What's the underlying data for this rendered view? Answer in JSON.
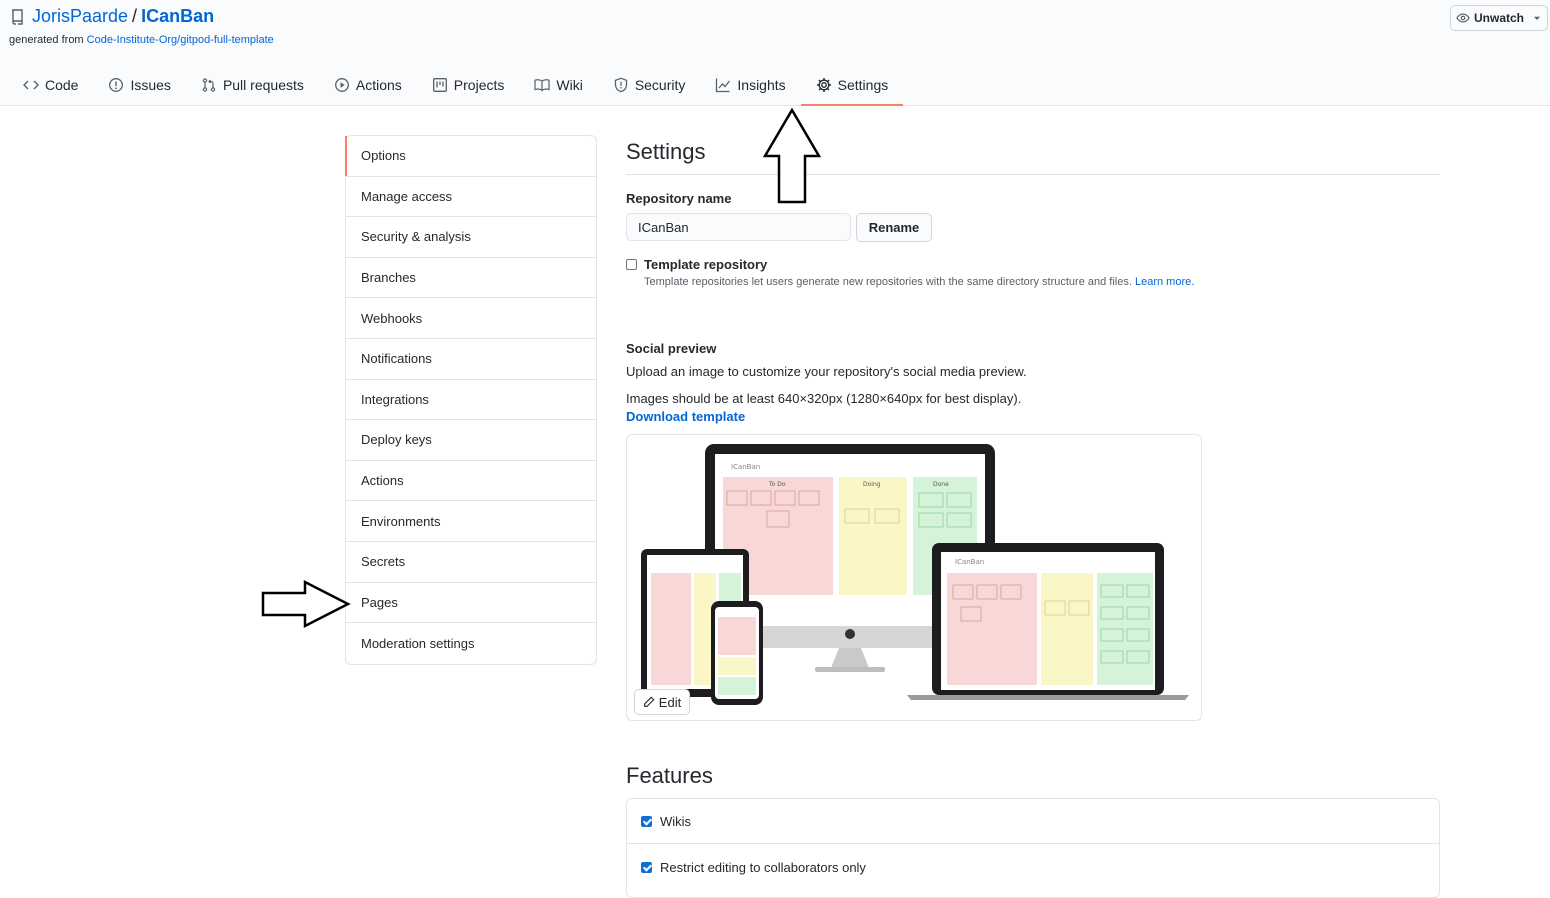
{
  "header": {
    "owner": "JorisPaarde",
    "separator": "/",
    "repo": "ICanBan",
    "generated_prefix": "generated from",
    "generated_link": "Code-Institute-Org/gitpod-full-template",
    "unwatch_label": "Unwatch"
  },
  "nav": {
    "items": [
      {
        "label": "Code",
        "icon": "code-icon"
      },
      {
        "label": "Issues",
        "icon": "issue-icon"
      },
      {
        "label": "Pull requests",
        "icon": "pull-request-icon"
      },
      {
        "label": "Actions",
        "icon": "play-icon"
      },
      {
        "label": "Projects",
        "icon": "project-icon"
      },
      {
        "label": "Wiki",
        "icon": "book-icon"
      },
      {
        "label": "Security",
        "icon": "shield-icon"
      },
      {
        "label": "Insights",
        "icon": "graph-icon"
      },
      {
        "label": "Settings",
        "icon": "gear-icon",
        "selected": true
      }
    ]
  },
  "menu": {
    "items": [
      {
        "label": "Options",
        "selected": true
      },
      {
        "label": "Manage access"
      },
      {
        "label": "Security & analysis"
      },
      {
        "label": "Branches"
      },
      {
        "label": "Webhooks"
      },
      {
        "label": "Notifications"
      },
      {
        "label": "Integrations"
      },
      {
        "label": "Deploy keys"
      },
      {
        "label": "Actions"
      },
      {
        "label": "Environments"
      },
      {
        "label": "Secrets"
      },
      {
        "label": "Pages"
      },
      {
        "label": "Moderation settings"
      }
    ]
  },
  "settings": {
    "title": "Settings",
    "repo_name_label": "Repository name",
    "repo_name_value": "ICanBan",
    "rename_label": "Rename",
    "template_label": "Template repository",
    "template_checked": false,
    "template_note": "Template repositories let users generate new repositories with the same directory structure and files.",
    "learn_more": "Learn more.",
    "social_title": "Social preview",
    "social_desc": "Upload an image to customize your repository's social media preview.",
    "social_size": "Images should be at least 640×320px (1280×640px for best display).",
    "download_template": "Download template",
    "edit_label": "Edit"
  },
  "preview": {
    "app_name": "ICanBan",
    "columns": [
      "To Do",
      "Doing",
      "Done"
    ],
    "column_colors": [
      "#f8d7d7",
      "#fbf6c6",
      "#d5f3d9"
    ]
  },
  "features": {
    "title": "Features",
    "items": [
      {
        "label": "Wikis",
        "checked": true
      },
      {
        "label": "Restrict editing to collaborators only",
        "checked": true
      }
    ]
  },
  "colors": {
    "accent": "#f9826c",
    "link": "#0366d6"
  }
}
